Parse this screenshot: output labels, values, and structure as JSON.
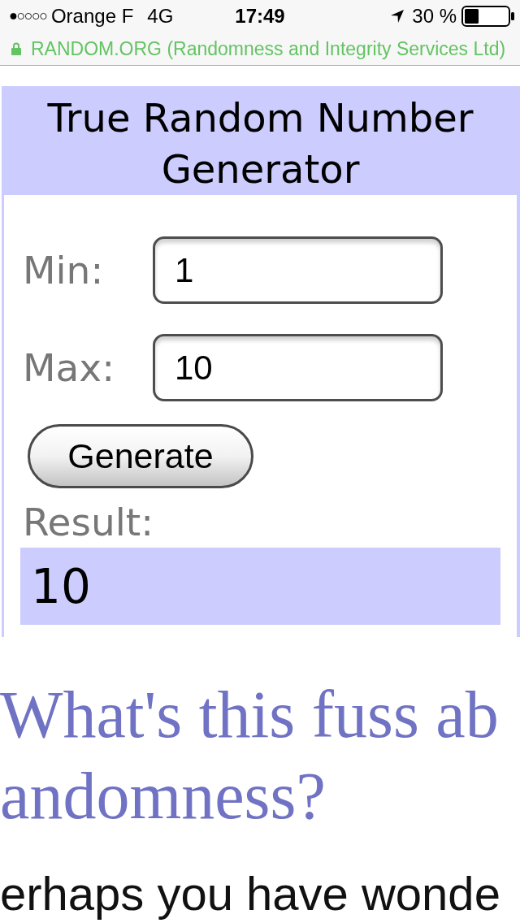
{
  "status_bar": {
    "carrier": "Orange F",
    "network": "4G",
    "time": "17:49",
    "battery": "30 %"
  },
  "address_bar": {
    "secure": true,
    "site": "RANDOM.ORG (Randomness and Integrity Services Ltd)"
  },
  "generator": {
    "title": "True Random Number Generator",
    "fields": [
      {
        "label": "Min:",
        "value": "1"
      },
      {
        "label": "Max:",
        "value": "10"
      }
    ],
    "button": "Generate",
    "result_label": "Result:",
    "result": "10"
  },
  "article": {
    "heading_lines": [
      "What's this fuss ab",
      "andomness?"
    ],
    "paragraph": "erhaps you have wonde"
  }
}
